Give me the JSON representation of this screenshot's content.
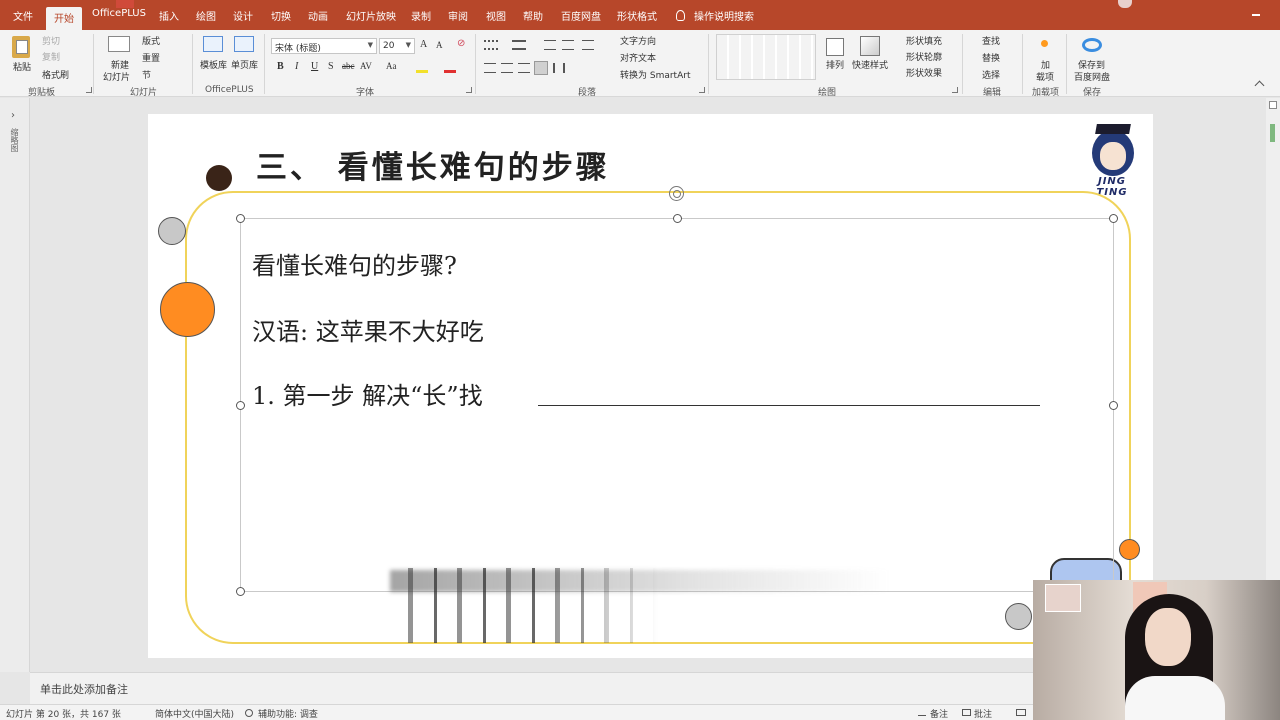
{
  "tabs": [
    {
      "label": "文件"
    },
    {
      "label": "开始"
    },
    {
      "label": "OfficePLUS"
    },
    {
      "label": "插入"
    },
    {
      "label": "绘图"
    },
    {
      "label": "设计"
    },
    {
      "label": "切换"
    },
    {
      "label": "动画"
    },
    {
      "label": "幻灯片放映"
    },
    {
      "label": "录制"
    },
    {
      "label": "审阅"
    },
    {
      "label": "视图"
    },
    {
      "label": "帮助"
    },
    {
      "label": "百度网盘"
    },
    {
      "label": "形状格式"
    }
  ],
  "search_label": "操作说明搜索",
  "ribbon": {
    "clipboard": {
      "paste": "粘贴",
      "cut": "剪切",
      "copy": "复制",
      "format_painter": "格式刷",
      "label": "剪贴板"
    },
    "slides": {
      "new_slide": "新建",
      "new_slide2": "幻灯片",
      "layout": "版式",
      "reset": "重置",
      "section": "节",
      "label": "幻灯片"
    },
    "officeplus": {
      "template": "模板库",
      "single": "单页库",
      "label": "OfficePLUS"
    },
    "font": {
      "name": "宋体 (标题)",
      "size": "20",
      "bold": "B",
      "italic": "I",
      "underline": "U",
      "strike": "S",
      "abc": "abc",
      "spacing": "AV",
      "case": "Aa",
      "label": "字体"
    },
    "paragraph": {
      "text_direction": "文字方向",
      "align_text": "对齐文本",
      "smartart": "转换为 SmartArt",
      "label": "段落"
    },
    "drawing": {
      "arrange": "排列",
      "quick_styles": "快速样式",
      "shape_fill": "形状填充",
      "shape_outline": "形状轮廓",
      "shape_effects": "形状效果",
      "label": "绘图"
    },
    "editing": {
      "find": "查找",
      "replace": "替换",
      "select": "选择",
      "label": "编辑"
    },
    "addins": {
      "addin1": "加",
      "addin2": "载项",
      "label": "加载项"
    },
    "save": {
      "save1": "保存到",
      "save2": "百度网盘",
      "label": "保存"
    }
  },
  "left_pane_label": "缩略图",
  "slide": {
    "title": "三、 看懂长难句的步骤",
    "line1": "看懂长难句的步骤?",
    "line2": "汉语:  这苹果不大好吃",
    "line3": "1. 第一步 解决“长”找",
    "logo_text": "JING TING"
  },
  "notes_placeholder": "单击此处添加备注",
  "status": {
    "slide_info": "幻灯片 第 20 张，共 167 张",
    "language": "简体中文(中国大陆)",
    "accessibility": "辅助功能: 调查",
    "notes": "备注",
    "comments": "批注"
  },
  "colors": {
    "accent": "#b7472a",
    "frame": "#f0d35a",
    "orange": "#ff8c21",
    "dark_circle": "#3a2418",
    "gray_circle": "#c8c8c8"
  }
}
